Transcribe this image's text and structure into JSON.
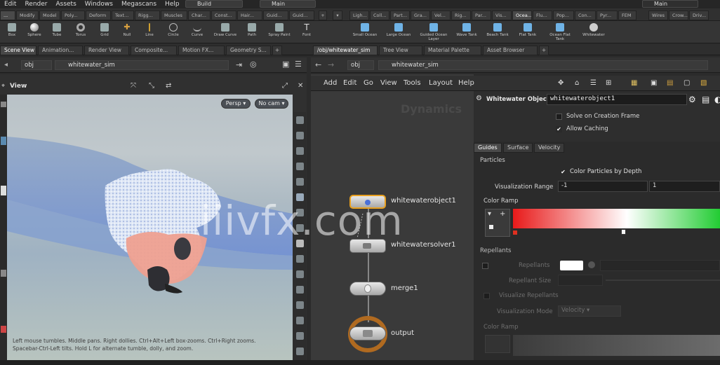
{
  "menubar": {
    "items": [
      "Edit",
      "Render",
      "Assets",
      "Windows",
      "Megascans",
      "Help"
    ],
    "desktop": "Build",
    "scene_view": "Main",
    "desktop_right": "Main"
  },
  "shelf_tabs_left": [
    "...",
    "Modify",
    "Model",
    "Poly...",
    "Deform",
    "Text...",
    "Rigg...",
    "Muscles",
    "Char...",
    "Const...",
    "Hair...",
    "Guid...",
    "Guid..."
  ],
  "shelf_tabs_right": [
    "Ligh...",
    "Coll...",
    "Part...",
    "Gra...",
    "Vel...",
    "Rig...",
    "Par...",
    "Vis...",
    "Ocea...",
    "Flu...",
    "Pop...",
    "Con...",
    "Pyr...",
    "FEM",
    "Wires",
    "Crow...",
    "Driv..."
  ],
  "tools_left": [
    "Box",
    "Sphere",
    "Tube",
    "Torus",
    "Grid",
    "Null",
    "Line",
    "Circle",
    "Curve",
    "Draw Curve",
    "Path",
    "Spray Paint",
    "Font"
  ],
  "tools_right": [
    "Small Ocean",
    "Large Ocean",
    "Guided Ocean Layer",
    "Wave Tank",
    "Beach Tank",
    "Flat Tank",
    "Ocean Flat Tank",
    "Whitewater"
  ],
  "pane_tabs_left": [
    "Scene View",
    "Animation...",
    "Render View",
    "Composite...",
    "Motion FX...",
    "Geometry S..."
  ],
  "pane_tabs_right": [
    "/obj/whitewater_sim",
    "Tree View",
    "Material Palette",
    "Asset Browser"
  ],
  "path_left": {
    "context": "obj",
    "node": "whitewater_sim"
  },
  "path_right": {
    "context": "obj",
    "node": "whitewater_sim"
  },
  "viewport": {
    "title": "View",
    "camera_persp": "Persp",
    "camera_nocam": "No cam",
    "help": "Left mouse tumbles. Middle pans. Right dollies. Ctrl+Alt+Left box-zooms. Ctrl+Right zooms. Spacebar-Ctrl-Left tilts. Hold L for alternate tumble, dolly, and zoom."
  },
  "network": {
    "menu": [
      "Add",
      "Edit",
      "Go",
      "View",
      "Tools",
      "Layout",
      "Help"
    ],
    "context_label": "Dynamics",
    "nodes": [
      "whitewaterobject1",
      "whitewatersolver1",
      "merge1",
      "output"
    ]
  },
  "params": {
    "type": "Whitewater Object",
    "name": "whitewaterobject1",
    "solve_on_creation": "Solve on Creation Frame",
    "allow_caching": "Allow Caching",
    "tabs": [
      "Guides",
      "Surface",
      "Velocity"
    ],
    "section_particles": "Particles",
    "color_by_depth": "Color Particles by Depth",
    "vis_range_label": "Visualization Range",
    "vis_range_min": "-1",
    "vis_range_max": "1",
    "color_ramp": "Color Ramp",
    "section_repellants": "Repellants",
    "repellants": "Repellants",
    "repellant_size": "Repellant Size",
    "visualize_repellants": "Visualize Repellants",
    "vis_mode": "Visualization Mode",
    "vis_mode_value": "Velocity",
    "color_ramp2": "Color Ramp"
  },
  "watermark": "iiivfx.com",
  "colors": {
    "accent_node": "#e8a020",
    "ramp_left": "#e81a1a",
    "ramp_right": "#22cc33"
  }
}
